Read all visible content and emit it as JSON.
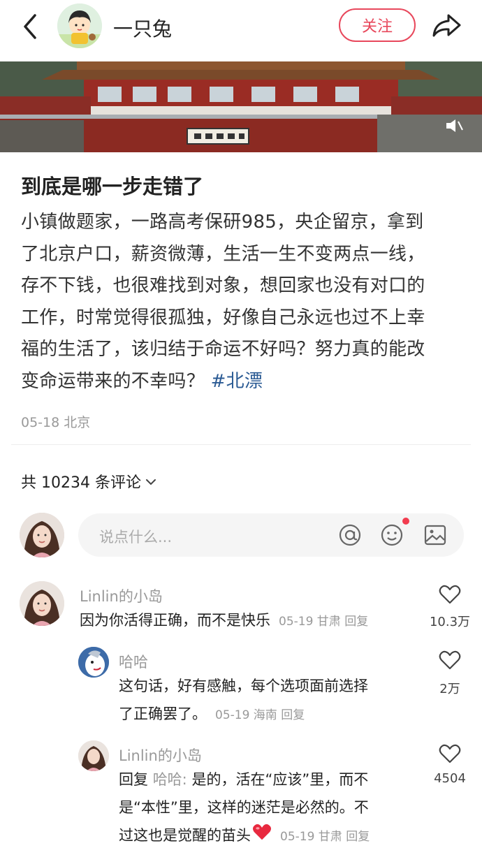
{
  "header": {
    "author_name": "一只兔",
    "follow_label": "关注"
  },
  "post": {
    "title": "到底是哪一步走错了",
    "body_lines": [
      "小镇做题家，一路高考保研985，央企留京，拿到",
      "了北京户口，薪资微薄，生活一生不变两点一线，",
      "存不下钱，也很难找到对象，想回家也没有对口的",
      "工作，时常觉得很孤独，好像自己永远也过不上幸",
      "福的生活了，该归结于命运不好吗？努力真的能改",
      "变命运带来的不幸吗？"
    ],
    "hashtag": "#北漂",
    "meta": "05-18 北京"
  },
  "comments_header": {
    "count_label": "共 10234 条评论"
  },
  "input": {
    "placeholder": "说点什么..."
  },
  "comments": [
    {
      "name": "Linlin的小岛",
      "text": "因为你活得正确，而不是快乐",
      "meta": "05-19 甘肃 回复",
      "likes": "10.3万"
    },
    {
      "name": "哈哈",
      "text_line1": "这句话，好有感触，每个选项面前选择",
      "text_line2": "了正确罢了。",
      "meta": "05-19 海南 回复",
      "likes": "2万"
    },
    {
      "name": "Linlin的小岛",
      "reply_prefix": "回复",
      "reply_to": "哈哈:",
      "text_line1": " 是的，活在“应该”里，而不",
      "text_line2": "是“本性”里，这样的迷茫是必然的。不",
      "text_line3": "过这也是觉醒的苗头",
      "meta": "05-19 甘肃 回复",
      "likes": "4504"
    }
  ],
  "colors": {
    "accent": "#e8485c",
    "hashtag": "#2b5b94",
    "meta_text": "#999999"
  },
  "icons": [
    "back-icon",
    "share-icon",
    "mute-icon",
    "chevron-down-icon",
    "at-icon",
    "emoji-icon",
    "image-icon",
    "heart-icon"
  ]
}
